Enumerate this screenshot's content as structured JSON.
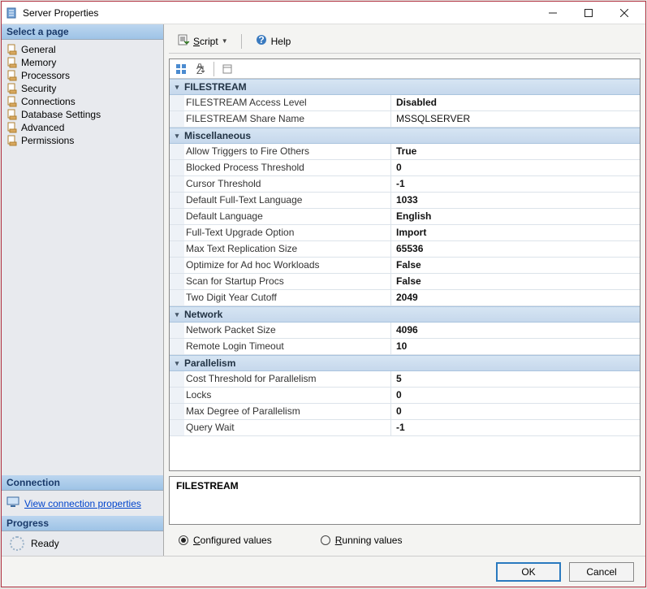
{
  "window": {
    "title": "Server Properties"
  },
  "left": {
    "select_header": "Select a page",
    "pages": [
      "General",
      "Memory",
      "Processors",
      "Security",
      "Connections",
      "Database Settings",
      "Advanced",
      "Permissions"
    ],
    "connection_header": "Connection",
    "view_conn_link": "View connection properties",
    "progress_header": "Progress",
    "progress_status": "Ready"
  },
  "toolbar": {
    "script_label": "Script",
    "help_label": "Help"
  },
  "grid": {
    "categories": [
      {
        "name": "FILESTREAM",
        "props": [
          {
            "name": "FILESTREAM Access Level",
            "value": "Disabled",
            "bold": true
          },
          {
            "name": "FILESTREAM Share Name",
            "value": "MSSQLSERVER",
            "bold": false
          }
        ]
      },
      {
        "name": "Miscellaneous",
        "props": [
          {
            "name": "Allow Triggers to Fire Others",
            "value": "True",
            "bold": true
          },
          {
            "name": "Blocked Process Threshold",
            "value": "0",
            "bold": true
          },
          {
            "name": "Cursor Threshold",
            "value": "-1",
            "bold": true
          },
          {
            "name": "Default Full-Text Language",
            "value": "1033",
            "bold": true
          },
          {
            "name": "Default Language",
            "value": "English",
            "bold": true
          },
          {
            "name": "Full-Text Upgrade Option",
            "value": "Import",
            "bold": true
          },
          {
            "name": "Max Text Replication Size",
            "value": "65536",
            "bold": true
          },
          {
            "name": "Optimize for Ad hoc Workloads",
            "value": "False",
            "bold": true
          },
          {
            "name": "Scan for Startup Procs",
            "value": "False",
            "bold": true
          },
          {
            "name": "Two Digit Year Cutoff",
            "value": "2049",
            "bold": true
          }
        ]
      },
      {
        "name": "Network",
        "props": [
          {
            "name": "Network Packet Size",
            "value": "4096",
            "bold": true
          },
          {
            "name": "Remote Login Timeout",
            "value": "10",
            "bold": true
          }
        ]
      },
      {
        "name": "Parallelism",
        "props": [
          {
            "name": "Cost Threshold for Parallelism",
            "value": "5",
            "bold": true
          },
          {
            "name": "Locks",
            "value": "0",
            "bold": true
          },
          {
            "name": "Max Degree of Parallelism",
            "value": "0",
            "bold": true
          },
          {
            "name": "Query Wait",
            "value": "-1",
            "bold": true
          }
        ]
      }
    ],
    "description_title": "FILESTREAM",
    "description_body": ""
  },
  "radios": {
    "configured": "Configured values",
    "running": "Running values",
    "selected": "configured"
  },
  "footer": {
    "ok": "OK",
    "cancel": "Cancel"
  }
}
